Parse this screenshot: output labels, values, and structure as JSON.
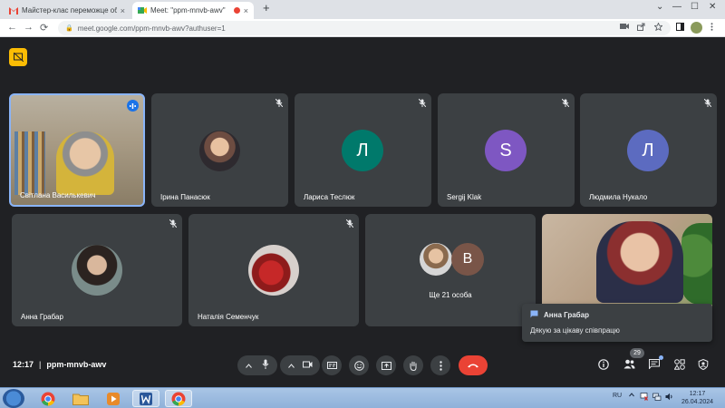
{
  "browser": {
    "tabs": [
      {
        "title": "Майстер-клас переможце обл",
        "icon": "gmail-icon"
      },
      {
        "title": "Meet: \"ppm-mnvb-awv\"",
        "icon": "meet-icon",
        "recording": true
      }
    ],
    "url": "meet.google.com/ppm-mnvb-awv?authuser=1",
    "controls": {
      "close": "×",
      "new_tab": "+",
      "back": "←",
      "forward": "→",
      "reload": "⟳",
      "minimize": "—",
      "maximize": "☐",
      "window_close": "✕",
      "tab_menu": "⌄",
      "lock": "🔒"
    }
  },
  "meeting": {
    "time": "12:17",
    "code": "ppm-mnvb-awv",
    "separator": "|",
    "participant_count": "29",
    "tiles": [
      {
        "name": "Світлана Василькевич",
        "type": "video",
        "speaking": true
      },
      {
        "name": "Ірина Панасюк",
        "type": "photo",
        "muted": true
      },
      {
        "name": "Лариса Теслюк",
        "type": "initial",
        "initial": "Л",
        "color": "#00796b",
        "muted": true
      },
      {
        "name": "Sergij Klak",
        "type": "initial",
        "initial": "S",
        "color": "#7e57c2",
        "muted": true
      },
      {
        "name": "Людмила Нукало",
        "type": "initial",
        "initial": "Л",
        "color": "#5c6bc0",
        "muted": true
      },
      {
        "name": "Анна Грабар",
        "type": "photo",
        "muted": true
      },
      {
        "name": "Наталія Семенчук",
        "type": "photo",
        "muted": true
      },
      {
        "name": "Ще 21 особа",
        "type": "more",
        "initial": "B",
        "color": "#795548"
      },
      {
        "name": "",
        "type": "video"
      }
    ],
    "toast": {
      "sender": "Анна Грабар",
      "message": "Дякую за цікаву співпрацю"
    }
  },
  "taskbar": {
    "lang": "RU",
    "time": "12:17",
    "date": "26.04.2024"
  }
}
